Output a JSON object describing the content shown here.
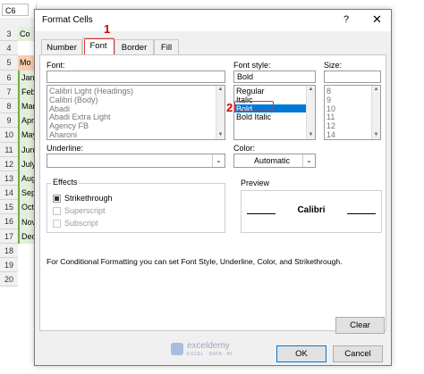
{
  "excel": {
    "name_box": "C6",
    "row_numbers": [
      "3",
      "4",
      "5",
      "6",
      "7",
      "8",
      "9",
      "10",
      "11",
      "12",
      "13",
      "14",
      "15",
      "16",
      "17",
      "18",
      "19",
      "20"
    ],
    "col_a_cells": [
      "Co",
      "",
      "Mo",
      "Jan",
      "Feb",
      "Mar",
      "Apr",
      "May",
      "Jun",
      "July",
      "Aug",
      "Sep",
      "Oct",
      "Nov",
      "Dec",
      "",
      "",
      ""
    ]
  },
  "dialog": {
    "title": "Format Cells",
    "help": "?",
    "close": "✕",
    "tabs": [
      "Number",
      "Font",
      "Border",
      "Fill"
    ],
    "active_tab": "Font",
    "font_label": "Font:",
    "font_value": "",
    "font_list": [
      "Calibri Light (Headings)",
      "Calibri (Body)",
      "Abadi",
      "Abadi Extra Light",
      "Agency FB",
      "Aharoni"
    ],
    "style_label": "Font style:",
    "style_value": "Bold",
    "style_list": [
      "Regular",
      "Italic",
      "Bold",
      "Bold Italic"
    ],
    "style_selected": "Bold",
    "size_label": "Size:",
    "size_value": "",
    "size_list": [
      "8",
      "9",
      "10",
      "11",
      "12",
      "14"
    ],
    "underline_label": "Underline:",
    "underline_value": "",
    "color_label": "Color:",
    "color_value": "Automatic",
    "effects_title": "Effects",
    "effects": [
      {
        "label": "Strikethrough",
        "checked": true,
        "enabled": true
      },
      {
        "label": "Superscript",
        "checked": false,
        "enabled": false
      },
      {
        "label": "Subscript",
        "checked": false,
        "enabled": false
      }
    ],
    "preview_title": "Preview",
    "preview_text": "Calibri",
    "info_text": "For Conditional Formatting you can set Font Style, Underline, Color, and Strikethrough.",
    "clear_label": "Clear",
    "ok_label": "OK",
    "cancel_label": "Cancel",
    "annotation_1": "1",
    "annotation_2": "2",
    "annotation_color": "#e03030",
    "selection_color": "#0078d7"
  },
  "watermark": {
    "brand": "exceldemy",
    "tagline": "EXCEL · DATA · BI"
  }
}
